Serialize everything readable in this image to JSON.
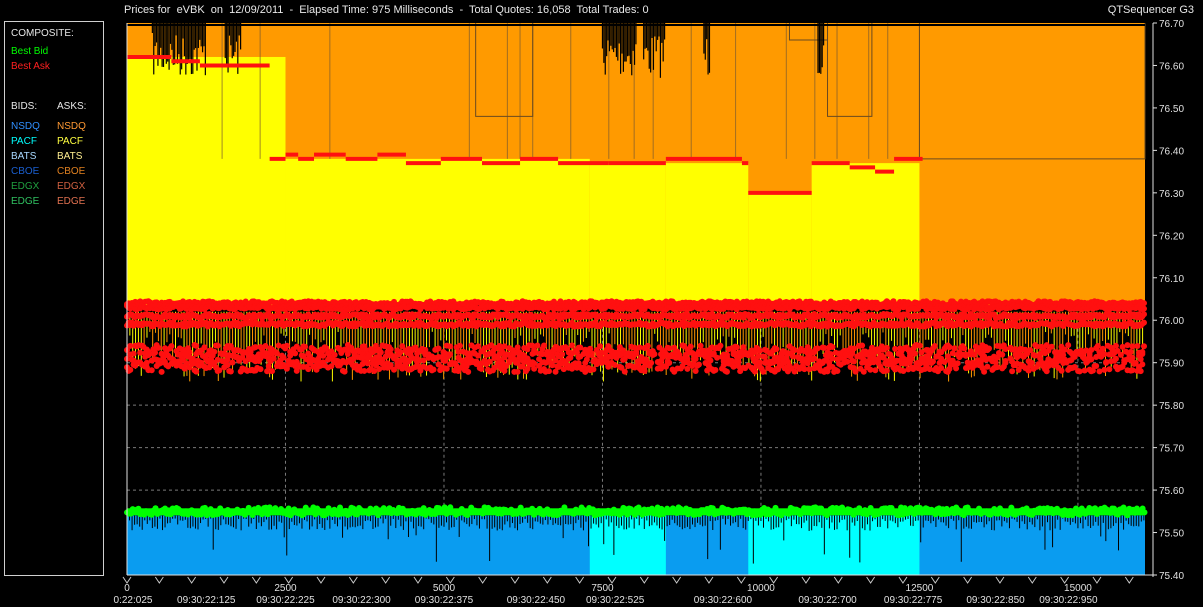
{
  "header": {
    "title": "Prices for  eVBK  on  12/09/2011  -  Elapsed Time: 975 Milliseconds  -  Total Quotes: 16,058  Total Trades: 0",
    "app_name": "QTSequencer G3"
  },
  "legend": {
    "composite_label": "COMPOSITE:",
    "best_bid": {
      "label": "Best Bid",
      "color": "#00ff00"
    },
    "best_ask": {
      "label": "Best Ask",
      "color": "#ff2020"
    },
    "bids_label": "BIDS:",
    "asks_label": "ASKS:",
    "bids": [
      {
        "label": "NSDQ",
        "color": "#2f8fff"
      },
      {
        "label": "PACF",
        "color": "#00ffff"
      },
      {
        "label": "BATS",
        "color": "#a8d8ff"
      },
      {
        "label": "CBOE",
        "color": "#1a5fd0"
      },
      {
        "label": "EDGX",
        "color": "#20a040"
      },
      {
        "label": "EDGE",
        "color": "#30c060"
      }
    ],
    "asks": [
      {
        "label": "NSDQ",
        "color": "#ff9933"
      },
      {
        "label": "PACF",
        "color": "#ffff40"
      },
      {
        "label": "BATS",
        "color": "#ffee90"
      },
      {
        "label": "CBOE",
        "color": "#e08020"
      },
      {
        "label": "EDGX",
        "color": "#d06040"
      },
      {
        "label": "EDGE",
        "color": "#e07050"
      }
    ]
  },
  "chart_data": {
    "type": "area",
    "xlim": [
      0,
      16058
    ],
    "ylim": [
      75.4,
      76.7
    ],
    "grid": true,
    "colors": {
      "ask_orange": "#ff9a00",
      "ask_yellow": "#ffff00",
      "bid_blue": "#0a9cf0",
      "bid_cyan": "#00ffff",
      "best_bid": "#00ff00",
      "best_ask": "#ff1010",
      "axis": "#e0e0e0"
    },
    "y_ticks": [
      "75.40",
      "75.50",
      "75.60",
      "75.70",
      "75.80",
      "75.90",
      "76.00",
      "76.10",
      "76.20",
      "76.30",
      "76.40",
      "76.50",
      "76.60",
      "76.70"
    ],
    "x_ticks": [
      {
        "value": 0,
        "label": "0"
      },
      {
        "value": 2500,
        "label": "2500"
      },
      {
        "value": 5000,
        "label": "5000"
      },
      {
        "value": 7500,
        "label": "7500"
      },
      {
        "value": 10000,
        "label": "10000"
      },
      {
        "value": 12500,
        "label": "12500"
      },
      {
        "value": 15000,
        "label": "15000"
      }
    ],
    "time_labels": [
      {
        "value": -200,
        "label": "0:22:025"
      },
      {
        "value": 1250,
        "label": "09:30:22:125"
      },
      {
        "value": 2500,
        "label": "09:30:22:225"
      },
      {
        "value": 3700,
        "label": "09:30:22:300"
      },
      {
        "value": 5000,
        "label": "09:30:22:375"
      },
      {
        "value": 6450,
        "label": "09:30:22:450"
      },
      {
        "value": 7700,
        "label": "09:30:22:525"
      },
      {
        "value": 9400,
        "label": "09:30:22:600"
      },
      {
        "value": 11050,
        "label": "09:30:22:700"
      },
      {
        "value": 12400,
        "label": "09:30:22:775"
      },
      {
        "value": 13700,
        "label": "09:30:22:850"
      },
      {
        "value": 14850,
        "label": "09:30:22:950"
      }
    ],
    "ask_regions": [
      {
        "x0": 0,
        "x1": 2500,
        "top": 76.62,
        "color": "yellow"
      },
      {
        "x0": 2500,
        "x1": 7300,
        "top": 76.38,
        "color": "yellow"
      },
      {
        "x0": 7300,
        "x1": 8500,
        "top": 76.37,
        "color": "yellow"
      },
      {
        "x0": 8500,
        "x1": 9800,
        "top": 76.37,
        "color": "yellow"
      },
      {
        "x0": 9800,
        "x1": 10800,
        "top": 76.3,
        "color": "yellow"
      },
      {
        "x0": 10800,
        "x1": 12500,
        "top": 76.37,
        "color": "yellow"
      }
    ],
    "ask_step": [
      {
        "x": 0,
        "y": 76.62
      },
      {
        "x": 700,
        "y": 76.61
      },
      {
        "x": 1150,
        "y": 76.6
      },
      {
        "x": 1600,
        "y": 76.6
      },
      {
        "x": 2250,
        "y": 76.38
      },
      {
        "x": 2500,
        "y": 76.39
      },
      {
        "x": 2700,
        "y": 76.38
      },
      {
        "x": 2950,
        "y": 76.39
      },
      {
        "x": 3450,
        "y": 76.38
      },
      {
        "x": 3950,
        "y": 76.39
      },
      {
        "x": 4400,
        "y": 76.37
      },
      {
        "x": 4950,
        "y": 76.38
      },
      {
        "x": 5600,
        "y": 76.37
      },
      {
        "x": 6200,
        "y": 76.38
      },
      {
        "x": 6800,
        "y": 76.37
      },
      {
        "x": 7600,
        "y": 76.37
      },
      {
        "x": 8500,
        "y": 76.38
      },
      {
        "x": 9700,
        "y": 76.37
      },
      {
        "x": 9800,
        "y": 76.3
      },
      {
        "x": 10800,
        "y": 76.37
      },
      {
        "x": 11400,
        "y": 76.36
      },
      {
        "x": 11800,
        "y": 76.35
      },
      {
        "x": 12100,
        "y": 76.38
      },
      {
        "x": 12550,
        "y": 76.38
      }
    ],
    "ask_bands": [
      76.04,
      76.03,
      76.01,
      75.99,
      75.93,
      75.91,
      75.89
    ],
    "best_bid_level": 75.55,
    "bid_top": 75.54,
    "bid_cyan_regions": [
      {
        "x0": 7300,
        "x1": 8500
      },
      {
        "x0": 9800,
        "x1": 12500
      }
    ]
  }
}
